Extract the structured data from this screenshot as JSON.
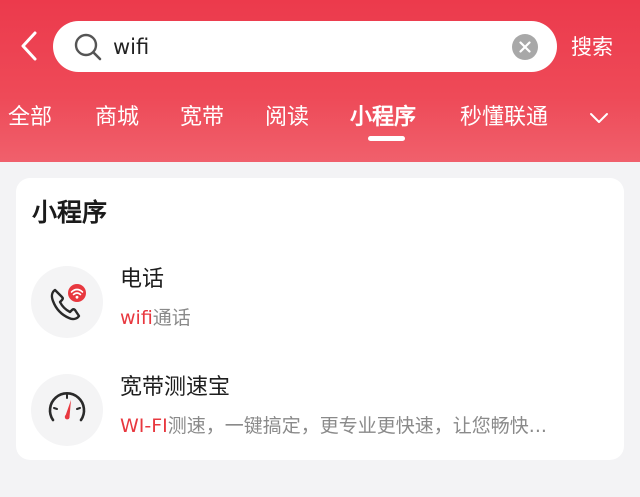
{
  "search": {
    "query": "wifi",
    "submit_label": "搜索"
  },
  "tabs": [
    {
      "label": "全部"
    },
    {
      "label": "商城"
    },
    {
      "label": "宽带"
    },
    {
      "label": "阅读"
    },
    {
      "label": "小程序",
      "active": true
    },
    {
      "label": "秒懂联通"
    }
  ],
  "section": {
    "title": "小程序",
    "items": [
      {
        "title": "电话",
        "desc_highlight": "wifi",
        "desc_rest": "通话",
        "icon": "wifi-phone-icon"
      },
      {
        "title": "宽带测速宝",
        "desc_highlight": "WI-FI",
        "desc_rest": "测速，一键搞定，更专业更快速，让您畅快...",
        "icon": "speedometer-icon"
      }
    ]
  },
  "colors": {
    "header": "#ec3a4c",
    "accent": "#e8383f"
  }
}
